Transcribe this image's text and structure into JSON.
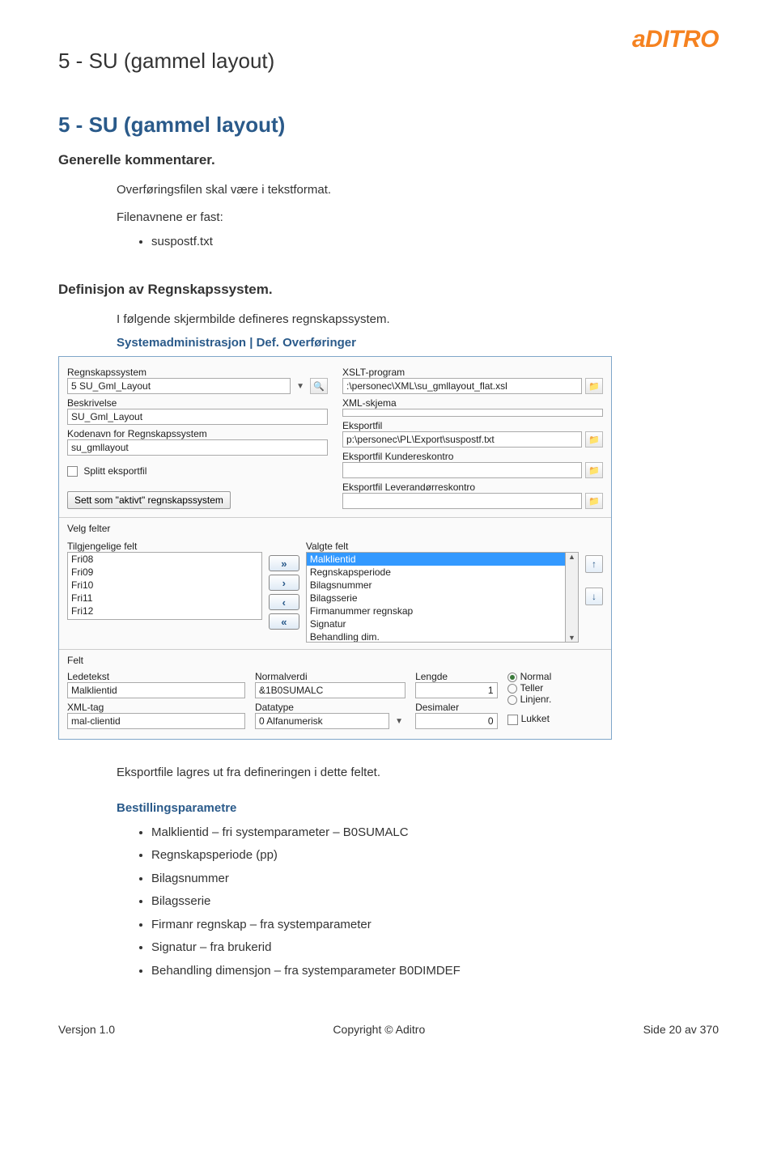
{
  "brand": "aDITRO",
  "header_title": "5 - SU (gammel layout)",
  "section_title": "5 - SU (gammel layout)",
  "generelle": {
    "heading": "Generelle kommentarer.",
    "line1": "Overføringsfilen skal være i tekstformat.",
    "line2": "Filenavnene er fast:",
    "bullet": "suspostf.txt"
  },
  "definisjon": {
    "heading": "Definisjon av Regnskapssystem.",
    "line1": "I følgende skjermbilde defineres regnskapssystem.",
    "path": "Systemadministrasjon | Def. Overføringer"
  },
  "panel": {
    "left_labels": {
      "regnskapssystem": "Regnskapssystem",
      "beskrivelse": "Beskrivelse",
      "kodenavn": "Kodenavn for Regnskapssystem",
      "splitt": "Splitt eksportfil",
      "sett_aktivt": "Sett som \"aktivt\" regnskapssystem"
    },
    "left_values": {
      "regnskapssystem": "5 SU_Gml_Layout",
      "beskrivelse": "SU_Gml_Layout",
      "kodenavn": "su_gmllayout"
    },
    "right_labels": {
      "xslt": "XSLT-program",
      "xml_skjema": "XML-skjema",
      "eksportfil": "Eksportfil",
      "eksport_kunde": "Eksportfil Kundereskontro",
      "eksport_lev": "Eksportfil Leverandørreskontro"
    },
    "right_values": {
      "xslt": ":\\personec\\XML\\su_gmllayout_flat.xsl",
      "eksportfil": "p:\\personec\\PL\\Export\\suspostf.txt"
    },
    "velg_felter": "Velg felter",
    "tilgjengelige": "Tilgjengelige felt",
    "valgte": "Valgte felt",
    "available": [
      "Fri08",
      "Fri09",
      "Fri10",
      "Fri11",
      "Fri12"
    ],
    "selected": [
      "Malklientid",
      "Regnskapsperiode",
      "Bilagsnummer",
      "Bilagsserie",
      "Firmanummer regnskap",
      "Signatur",
      "Behandling dim."
    ],
    "felt_section": "Felt",
    "ledetekst_lbl": "Ledetekst",
    "ledetekst_val": "Malklientid",
    "xmltag_lbl": "XML-tag",
    "xmltag_val": "mal-clientid",
    "normalverdi_lbl": "Normalverdi",
    "normalverdi_val": "&1B0SUMALC",
    "datatype_lbl": "Datatype",
    "datatype_val": "0 Alfanumerisk",
    "lengde_lbl": "Lengde",
    "lengde_val": "1",
    "desimaler_lbl": "Desimaler",
    "desimaler_val": "0",
    "radios": {
      "normal": "Normal",
      "teller": "Teller",
      "linjenr": "Linjenr."
    },
    "lukket": "Lukket"
  },
  "eksportfile_text": "Eksportfile lagres ut fra defineringen i dette feltet.",
  "bestilling": {
    "heading": "Bestillingsparametre",
    "items": [
      "Malklientid – fri systemparameter – B0SUMALC",
      "Regnskapsperiode (pp)",
      "Bilagsnummer",
      "Bilagsserie",
      "Firmanr regnskap – fra systemparameter",
      "Signatur – fra brukerid",
      "Behandling dimensjon – fra systemparameter B0DIMDEF"
    ]
  },
  "footer": {
    "version": "Versjon 1.0",
    "copyright": "Copyright © Aditro",
    "page": "Side 20 av 370"
  }
}
